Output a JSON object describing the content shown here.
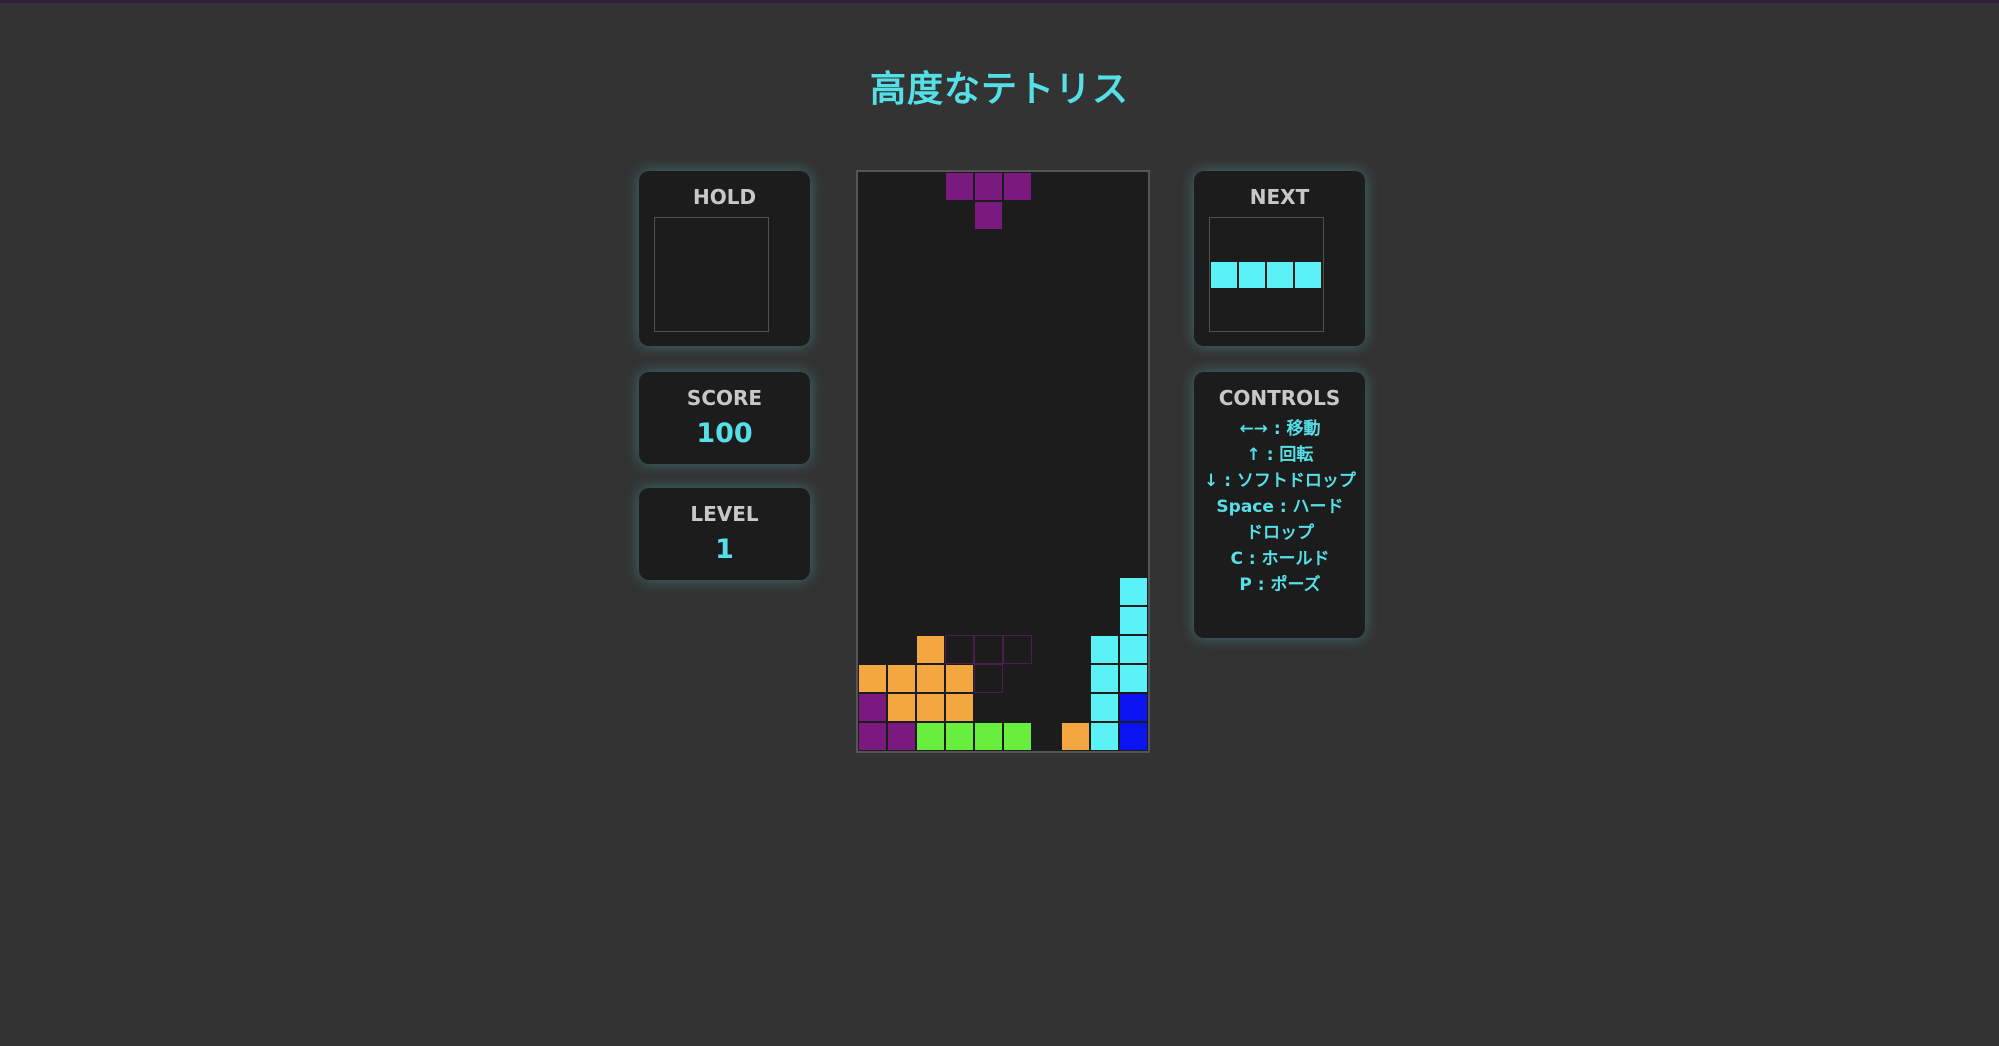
{
  "title": "高度なテトリス",
  "hold": {
    "label": "HOLD"
  },
  "score": {
    "label": "SCORE",
    "value": "100"
  },
  "level": {
    "label": "LEVEL",
    "value": "1"
  },
  "next": {
    "label": "NEXT",
    "piece": "I",
    "color": "#5af2f7"
  },
  "controls": {
    "label": "CONTROLS",
    "lines": [
      "←→ : 移動",
      "↑ : 回転",
      "↓ : ソフトドロップ",
      "Space : ハード",
      "ドロップ",
      "C : ホールド",
      "P : ポーズ"
    ]
  },
  "colors": {
    "accent": "#55e0e8",
    "T": "#7a1a7e",
    "I": "#5af2f7",
    "L": "#f4a640",
    "S": "#68ef3e",
    "J": "#0a14f0"
  },
  "board": {
    "cols": 10,
    "rows": 20,
    "active_piece": {
      "type": "T",
      "cells": [
        [
          3,
          0
        ],
        [
          4,
          0
        ],
        [
          5,
          0
        ],
        [
          4,
          1
        ]
      ]
    },
    "ghost_cells": [
      [
        3,
        16
      ],
      [
        4,
        16
      ],
      [
        5,
        16
      ],
      [
        4,
        17
      ]
    ],
    "locked": [
      {
        "x": 9,
        "y": 14,
        "c": "I"
      },
      {
        "x": 9,
        "y": 15,
        "c": "I"
      },
      {
        "x": 2,
        "y": 16,
        "c": "L"
      },
      {
        "x": 8,
        "y": 16,
        "c": "I"
      },
      {
        "x": 9,
        "y": 16,
        "c": "I"
      },
      {
        "x": 0,
        "y": 17,
        "c": "L"
      },
      {
        "x": 1,
        "y": 17,
        "c": "L"
      },
      {
        "x": 2,
        "y": 17,
        "c": "L"
      },
      {
        "x": 3,
        "y": 17,
        "c": "L"
      },
      {
        "x": 8,
        "y": 17,
        "c": "I"
      },
      {
        "x": 9,
        "y": 17,
        "c": "I"
      },
      {
        "x": 0,
        "y": 18,
        "c": "T"
      },
      {
        "x": 1,
        "y": 18,
        "c": "L"
      },
      {
        "x": 2,
        "y": 18,
        "c": "L"
      },
      {
        "x": 3,
        "y": 18,
        "c": "L"
      },
      {
        "x": 8,
        "y": 18,
        "c": "I"
      },
      {
        "x": 9,
        "y": 18,
        "c": "J"
      },
      {
        "x": 0,
        "y": 19,
        "c": "T"
      },
      {
        "x": 1,
        "y": 19,
        "c": "T"
      },
      {
        "x": 2,
        "y": 19,
        "c": "S"
      },
      {
        "x": 3,
        "y": 19,
        "c": "S"
      },
      {
        "x": 4,
        "y": 19,
        "c": "S"
      },
      {
        "x": 5,
        "y": 19,
        "c": "S"
      },
      {
        "x": 7,
        "y": 19,
        "c": "L"
      },
      {
        "x": 8,
        "y": 19,
        "c": "I"
      },
      {
        "x": 9,
        "y": 19,
        "c": "J"
      }
    ]
  }
}
